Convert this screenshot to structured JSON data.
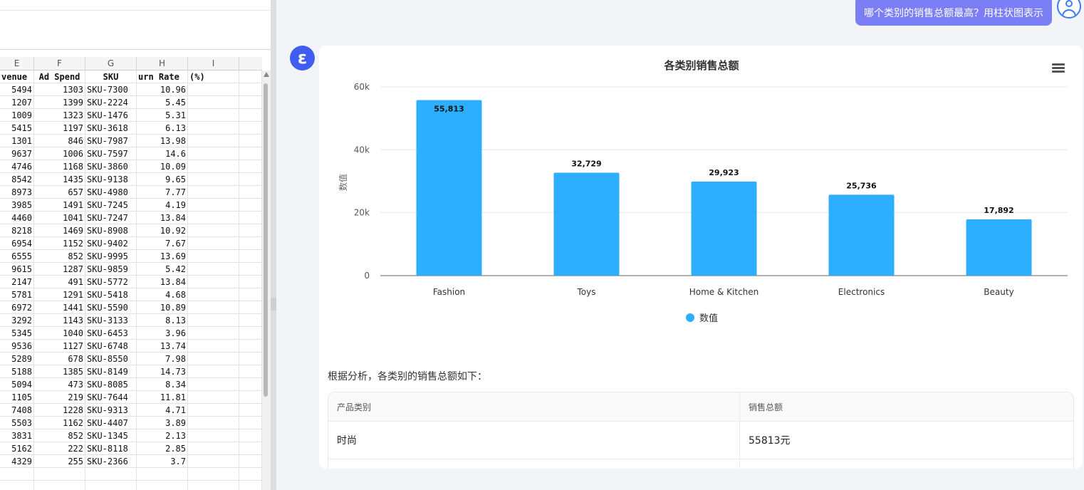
{
  "spreadsheet": {
    "columns": [
      "E",
      "F",
      "G",
      "H",
      "I"
    ],
    "header_row": [
      "venue",
      "Ad Spend",
      "SKU",
      "urn Rate",
      "(%)"
    ],
    "rows": [
      [
        "5494",
        "1303",
        "SKU-7300",
        "10.96"
      ],
      [
        "1207",
        "1399",
        "SKU-2224",
        "5.45"
      ],
      [
        "1009",
        "1323",
        "SKU-1476",
        "5.31"
      ],
      [
        "5415",
        "1197",
        "SKU-3618",
        "6.13"
      ],
      [
        "1301",
        "846",
        "SKU-7987",
        "13.98"
      ],
      [
        "9637",
        "1006",
        "SKU-7597",
        "14.6"
      ],
      [
        "4746",
        "1168",
        "SKU-3860",
        "10.09"
      ],
      [
        "8542",
        "1435",
        "SKU-9138",
        "9.65"
      ],
      [
        "8973",
        "657",
        "SKU-4980",
        "7.77"
      ],
      [
        "3985",
        "1491",
        "SKU-7245",
        "4.19"
      ],
      [
        "4460",
        "1041",
        "SKU-7247",
        "13.84"
      ],
      [
        "8218",
        "1469",
        "SKU-8908",
        "10.92"
      ],
      [
        "6954",
        "1152",
        "SKU-9402",
        "7.67"
      ],
      [
        "6555",
        "852",
        "SKU-9995",
        "13.69"
      ],
      [
        "9615",
        "1287",
        "SKU-9859",
        "5.42"
      ],
      [
        "2147",
        "491",
        "SKU-5772",
        "13.84"
      ],
      [
        "5781",
        "1291",
        "SKU-5418",
        "4.68"
      ],
      [
        "6972",
        "1441",
        "SKU-5590",
        "10.89"
      ],
      [
        "3292",
        "1143",
        "SKU-3133",
        "8.13"
      ],
      [
        "5345",
        "1040",
        "SKU-6453",
        "3.96"
      ],
      [
        "9536",
        "1127",
        "SKU-6748",
        "13.74"
      ],
      [
        "5289",
        "678",
        "SKU-8550",
        "7.98"
      ],
      [
        "5188",
        "1385",
        "SKU-8149",
        "14.73"
      ],
      [
        "5094",
        "473",
        "SKU-8085",
        "8.34"
      ],
      [
        "1105",
        "219",
        "SKU-7644",
        "11.81"
      ],
      [
        "7408",
        "1228",
        "SKU-9313",
        "4.71"
      ],
      [
        "5503",
        "1162",
        "SKU-4407",
        "3.89"
      ],
      [
        "3831",
        "852",
        "SKU-1345",
        "2.13"
      ],
      [
        "5162",
        "222",
        "SKU-8118",
        "2.85"
      ],
      [
        "4329",
        "255",
        "SKU-2366",
        "3.7"
      ]
    ]
  },
  "chat": {
    "user_message": "哪个类别的销售总额最高？用柱状图表示",
    "bot_avatar_letter": "ε",
    "intro_text": "根据分析，各类别的销售总额如下：",
    "table": {
      "headers": [
        "产品类别",
        "销售总额"
      ],
      "rows": [
        [
          "时尚",
          "55813元"
        ]
      ]
    }
  },
  "chart_data": {
    "type": "bar",
    "title": "各类别销售总额",
    "ylabel": "数值",
    "categories": [
      "Fashion",
      "Toys",
      "Home & Kitchen",
      "Electronics",
      "Beauty"
    ],
    "series": [
      {
        "name": "数值",
        "values": [
          55813,
          32729,
          29923,
          25736,
          17892
        ]
      }
    ],
    "data_labels": [
      "55,813",
      "32,729",
      "29,923",
      "25,736",
      "17,892"
    ],
    "yticks": [
      "0",
      "20k",
      "40k",
      "60k"
    ],
    "ylim": [
      0,
      60000
    ],
    "grid": true,
    "legend_position": "bottom-center",
    "bar_color": "#2eaeff"
  }
}
